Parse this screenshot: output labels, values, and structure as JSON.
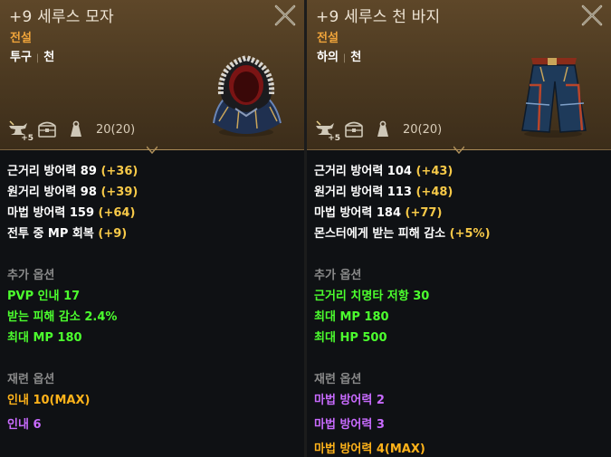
{
  "left": {
    "title": "+9 세루스 모자",
    "grade": "전설",
    "type_a": "투구",
    "type_sep": "|",
    "type_b": "천",
    "enhance_badge": "+5",
    "weight": "20(20)",
    "stats": [
      {
        "label": "근거리 방어력 89 ",
        "bonus": "(+36)"
      },
      {
        "label": "원거리 방어력 98 ",
        "bonus": "(+39)"
      },
      {
        "label": "마법 방어력 159 ",
        "bonus": "(+64)"
      },
      {
        "label": "전투 중 MP 회복  ",
        "bonus": "(+9)"
      }
    ],
    "extra_header": "추가 옵션",
    "extra": [
      "PVP 인내 17",
      "받는 피해 감소 2.4%",
      "최대 MP 180"
    ],
    "refine_header": "재련 옵션",
    "refine": [
      "인내 10(MAX)",
      "인내 6"
    ]
  },
  "right": {
    "title": "+9 세루스 천 바지",
    "grade": "전설",
    "type_a": "하의",
    "type_sep": "|",
    "type_b": "천",
    "enhance_badge": "+5",
    "weight": "20(20)",
    "stats": [
      {
        "label": "근거리 방어력 104 ",
        "bonus": "(+43)"
      },
      {
        "label": "원거리 방어력 113 ",
        "bonus": "(+48)"
      },
      {
        "label": "마법 방어력 184 ",
        "bonus": "(+77)"
      },
      {
        "label": "몬스터에게 받는 피해 감소  ",
        "bonus": "(+5%)"
      }
    ],
    "extra_header": "추가 옵션",
    "extra": [
      "근거리 치명타 저항 30",
      "최대 MP 180",
      "최대 HP 500"
    ],
    "refine_header": "재련 옵션",
    "refine": [
      "마법 방어력 2",
      "마법 방어력 3",
      "마법 방어력 4(MAX)"
    ]
  },
  "colors": {
    "grade": "#f0a43a",
    "bonus": "#f7c948",
    "extra_option": "#4cff2e",
    "refine_orange": "#ffb31a",
    "refine_purple": "#c96bff"
  },
  "icons": [
    "close-icon",
    "anvil-enhance-icon",
    "chest-storage-icon",
    "weight-icon"
  ]
}
